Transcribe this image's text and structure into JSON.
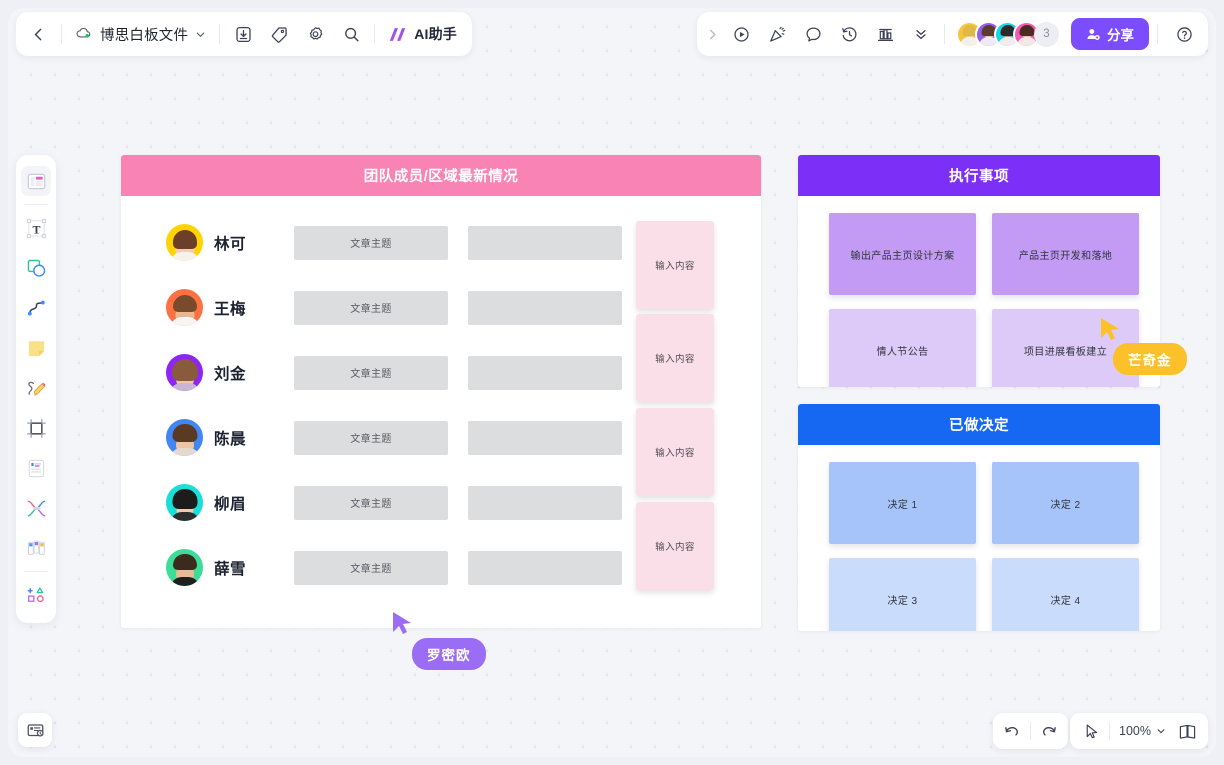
{
  "app": {
    "file_name": "博思白板文件",
    "zoom_level": "100%"
  },
  "topbar_left": {
    "back_label": "返回",
    "file_name": "博思白板文件",
    "dropdown_icon": "chevron-down-icon",
    "tools": [
      {
        "name": "download-icon",
        "label": "下载"
      },
      {
        "name": "tag-icon",
        "label": "标签"
      },
      {
        "name": "settings-icon",
        "label": "设置"
      },
      {
        "name": "search-icon",
        "label": "搜索"
      }
    ],
    "ai_label": "AI助手"
  },
  "topbar_right": {
    "expand_icon": "chevron-right-icon",
    "tools": [
      {
        "name": "play-icon",
        "label": "演示"
      },
      {
        "name": "celebrate-icon",
        "label": "庆祝"
      },
      {
        "name": "comment-icon",
        "label": "评论"
      },
      {
        "name": "history-icon",
        "label": "历史"
      },
      {
        "name": "template-icon",
        "label": "模板"
      },
      {
        "name": "more-icon",
        "label": "更多"
      }
    ],
    "collaborators": [
      {
        "name": "协作者1",
        "ring": "#f5c542",
        "hair": "#e8c34a"
      },
      {
        "name": "协作者2",
        "ring": "#9b5de5",
        "hair": "#5b3b2e"
      },
      {
        "name": "协作者3",
        "ring": "#16d6e0",
        "hair": "#2b2b2b"
      },
      {
        "name": "协作者4",
        "ring": "#f45bb5",
        "hair": "#4a2c20"
      }
    ],
    "collaborator_extra": "3",
    "share_label": "分享",
    "help_label": "帮助"
  },
  "left_rail": {
    "items": [
      {
        "name": "frame-tool",
        "label": "画框"
      },
      {
        "name": "text-tool",
        "label": "文本"
      },
      {
        "name": "shape-tool",
        "label": "形状"
      },
      {
        "name": "connector-tool",
        "label": "连线"
      },
      {
        "name": "sticky-note-tool",
        "label": "便签"
      },
      {
        "name": "pen-tool",
        "label": "画笔"
      },
      {
        "name": "crop-tool",
        "label": "裁剪"
      },
      {
        "name": "card-tool",
        "label": "卡片"
      },
      {
        "name": "mindmap-tool",
        "label": "思维导图"
      },
      {
        "name": "kanban-tool",
        "label": "看板"
      },
      {
        "name": "more-shapes-tool",
        "label": "更多"
      }
    ]
  },
  "bottom_left": {
    "present_label": "演示模式"
  },
  "bottom_right": {
    "undo_label": "撤销",
    "redo_label": "重做",
    "pointer_label": "选择",
    "zoom_level": "100%",
    "zoom_caret": "chevron-down-icon",
    "pages_label": "页面"
  },
  "main_board": {
    "title": "团队成员/区域最新情况",
    "header_color": "#f983b4",
    "column_placeholder": "文章主题",
    "members": [
      {
        "name": "林可",
        "bg": "#ffd400",
        "hair": "#6b3f2a",
        "skin": "#f2cdb4",
        "cloth": "#f5f2ee",
        "cell_a": "文章主题",
        "cell_b": ""
      },
      {
        "name": "王梅",
        "bg": "#ff7043",
        "hair": "#7a4a2c",
        "skin": "#e8b894",
        "cloth": "#f7f5f2",
        "cell_a": "文章主题",
        "cell_b": ""
      },
      {
        "name": "刘金",
        "bg": "#8e24f5",
        "hair": "#8a5a3c",
        "skin": "#efc6a8",
        "cloth": "#c8b6d4",
        "cell_a": "文章主题",
        "cell_b": ""
      },
      {
        "name": "陈晨",
        "bg": "#4285f4",
        "hair": "#5a3a22",
        "skin": "#eec4a6",
        "cloth": "#e3d9cf",
        "cell_a": "文章主题",
        "cell_b": ""
      },
      {
        "name": "柳眉",
        "bg": "#18e0d8",
        "hair": "#1c1c1c",
        "skin": "#f0cdb2",
        "cloth": "#2e2e2e",
        "cell_a": "文章主题",
        "cell_b": ""
      },
      {
        "name": "薛雪",
        "bg": "#3ddc97",
        "hair": "#3c2a1e",
        "skin": "#e8bb97",
        "cloth": "#1f1f1f",
        "cell_a": "文章主题",
        "cell_b": ""
      }
    ],
    "sticky_notes": [
      {
        "text": "输入内容",
        "color": "#fbdfe8"
      },
      {
        "text": "输入内容",
        "color": "#fbdfe8"
      },
      {
        "text": "输入内容",
        "color": "#fbdfe8"
      },
      {
        "text": "输入内容",
        "color": "#fbdfe8"
      }
    ]
  },
  "exec_panel": {
    "title": "执行事项",
    "header_color": "#7b2ff7",
    "cards": [
      {
        "text": "输出产品主页设计方案",
        "color": "#c39bf5"
      },
      {
        "text": "产品主页开发和落地",
        "color": "#c39bf5"
      },
      {
        "text": "情人节公告",
        "color": "#ddcaf9"
      },
      {
        "text": "项目进展看板建立",
        "color": "#ddcaf9"
      }
    ]
  },
  "decision_panel": {
    "title": "已做决定",
    "header_color": "#1667f2",
    "cards": [
      {
        "text": "决定 1",
        "color": "#a6c4fa"
      },
      {
        "text": "决定 2",
        "color": "#a6c4fa"
      },
      {
        "text": "决定 3",
        "color": "#cadcfb"
      },
      {
        "text": "决定 4",
        "color": "#cadcfb"
      }
    ]
  },
  "cursors": [
    {
      "name": "罗密欧",
      "color": "#9b6df5"
    },
    {
      "name": "芒奇金",
      "color": "#fbc02a"
    }
  ]
}
